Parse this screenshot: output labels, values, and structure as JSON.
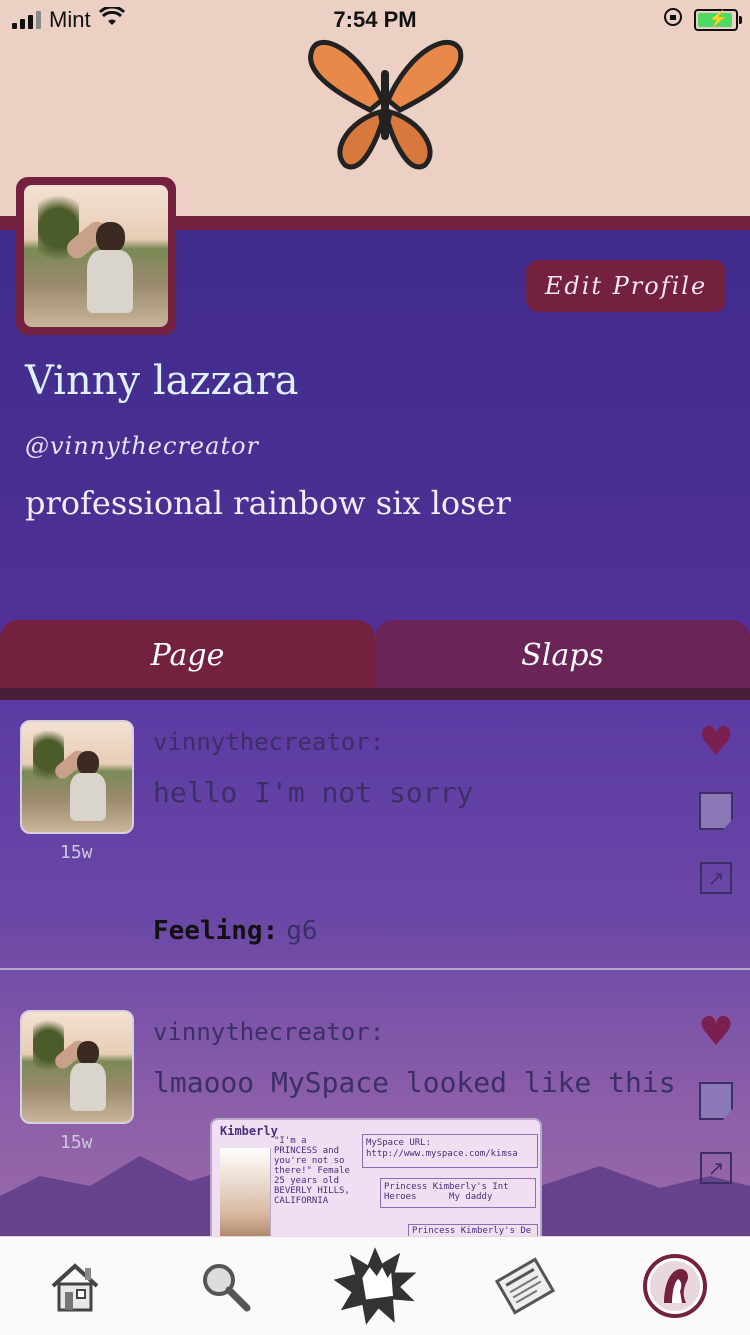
{
  "status_bar": {
    "carrier": "Mint",
    "time": "7:54 PM"
  },
  "profile": {
    "edit_label": "Edit Profile",
    "name": "Vinny lazzara",
    "handle": "@vinnythecreator",
    "bio": "professional rainbow six loser"
  },
  "tabs": [
    {
      "label": "Page",
      "selected": true
    },
    {
      "label": "Slaps",
      "selected": false
    }
  ],
  "posts": [
    {
      "user": "vinnythecreator:",
      "text": "hello I'm not sorry",
      "ago": "15w",
      "feeling_label": "Feeling:",
      "feeling_value": "g6"
    },
    {
      "user": "vinnythecreator:",
      "text": "lmaooo MySpace looked like this",
      "ago": "15w",
      "attachment": {
        "name": "Kimberly",
        "about": "\"I'm a PRINCESS and you're not so there!\" Female 25 years old BEVERLY HILLS, CALIFORNIA",
        "url_label": "MySpace URL:",
        "url": "http://www.myspace.com/kimsa",
        "interests_title": "Princess Kimberly's Int",
        "heroes_label": "Heroes",
        "heroes_value": "My daddy",
        "details_title": "Princess Kimberly's De"
      }
    }
  ],
  "bottom_nav": [
    {
      "icon": "home-icon"
    },
    {
      "icon": "search-icon"
    },
    {
      "icon": "slap-icon"
    },
    {
      "icon": "news-icon"
    },
    {
      "icon": "profile-icon"
    }
  ],
  "colors": {
    "banner": "#ecd0c4",
    "accent": "#74213f",
    "profile_bg": "#4a2f92"
  }
}
